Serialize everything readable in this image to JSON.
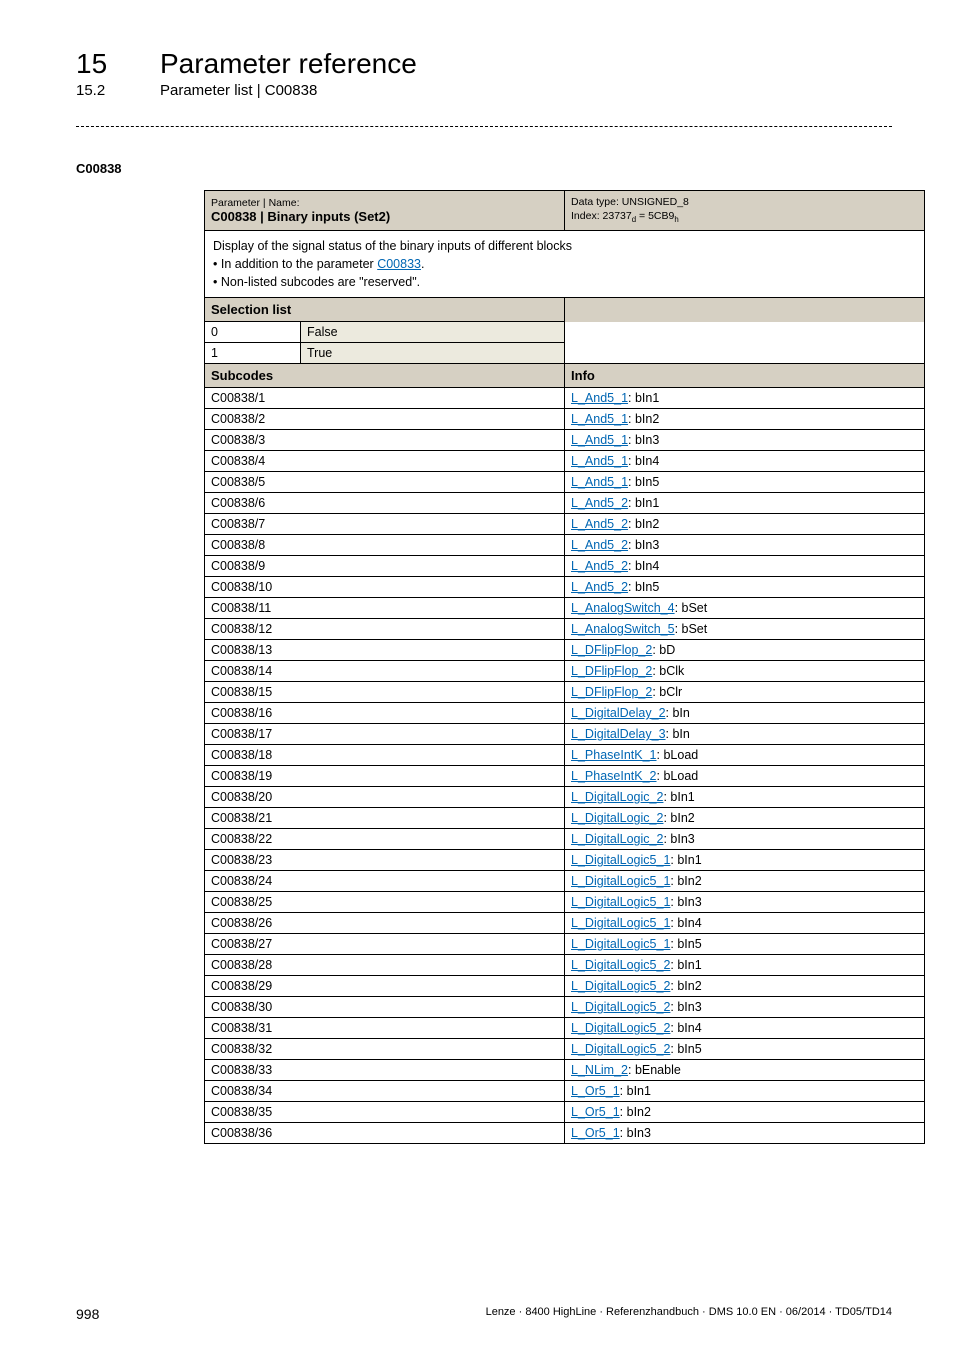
{
  "header": {
    "chapter_num": "15",
    "chapter_title": "Parameter reference",
    "section_num": "15.2",
    "section_title": "Parameter list | C00838"
  },
  "anchor": "C00838",
  "param_header": {
    "label": "Parameter | Name:",
    "name": "C00838 | Binary inputs (Set2)",
    "dtype": "Data type: UNSIGNED_8",
    "index_prefix": "Index: 23737",
    "index_sub1": "d",
    "index_mid": " = 5CB9",
    "index_sub2": "h"
  },
  "description": {
    "line1": "Display of the signal status of the binary inputs of different blocks",
    "bullet1_pre": " • In addition to the parameter ",
    "bullet1_link": "C00833",
    "bullet1_post": ".",
    "bullet2": " • Non-listed subcodes are \"reserved\"."
  },
  "labels": {
    "selection_list": "Selection list",
    "subcodes": "Subcodes",
    "info": "Info"
  },
  "selection": [
    {
      "val": "0",
      "label": "False"
    },
    {
      "val": "1",
      "label": "True"
    }
  ],
  "rows": [
    {
      "code": "C00838/1",
      "link": "L_And5_1",
      "suffix": ": bIn1"
    },
    {
      "code": "C00838/2",
      "link": "L_And5_1",
      "suffix": ": bIn2"
    },
    {
      "code": "C00838/3",
      "link": "L_And5_1",
      "suffix": ": bIn3"
    },
    {
      "code": "C00838/4",
      "link": "L_And5_1",
      "suffix": ": bIn4"
    },
    {
      "code": "C00838/5",
      "link": "L_And5_1",
      "suffix": ": bIn5"
    },
    {
      "code": "C00838/6",
      "link": "L_And5_2",
      "suffix": ": bIn1"
    },
    {
      "code": "C00838/7",
      "link": "L_And5_2",
      "suffix": ": bIn2"
    },
    {
      "code": "C00838/8",
      "link": "L_And5_2",
      "suffix": ": bIn3"
    },
    {
      "code": "C00838/9",
      "link": "L_And5_2",
      "suffix": ": bIn4"
    },
    {
      "code": "C00838/10",
      "link": "L_And5_2",
      "suffix": ": bIn5"
    },
    {
      "code": "C00838/11",
      "link": "L_AnalogSwitch_4",
      "suffix": ": bSet"
    },
    {
      "code": "C00838/12",
      "link": "L_AnalogSwitch_5",
      "suffix": ": bSet"
    },
    {
      "code": "C00838/13",
      "link": "L_DFlipFlop_2",
      "suffix": ": bD"
    },
    {
      "code": "C00838/14",
      "link": "L_DFlipFlop_2",
      "suffix": ": bClk"
    },
    {
      "code": "C00838/15",
      "link": "L_DFlipFlop_2",
      "suffix": ": bClr"
    },
    {
      "code": "C00838/16",
      "link": "L_DigitalDelay_2",
      "suffix": ": bIn"
    },
    {
      "code": "C00838/17",
      "link": "L_DigitalDelay_3",
      "suffix": ": bIn"
    },
    {
      "code": "C00838/18",
      "link": "L_PhaseIntK_1",
      "suffix": ": bLoad"
    },
    {
      "code": "C00838/19",
      "link": "L_PhaseIntK_2",
      "suffix": ": bLoad"
    },
    {
      "code": "C00838/20",
      "link": "L_DigitalLogic_2",
      "suffix": ": bIn1"
    },
    {
      "code": "C00838/21",
      "link": "L_DigitalLogic_2",
      "suffix": ": bIn2"
    },
    {
      "code": "C00838/22",
      "link": "L_DigitalLogic_2",
      "suffix": ": bIn3"
    },
    {
      "code": "C00838/23",
      "link": "L_DigitalLogic5_1",
      "suffix": ": bIn1"
    },
    {
      "code": "C00838/24",
      "link": "L_DigitalLogic5_1",
      "suffix": ": bIn2"
    },
    {
      "code": "C00838/25",
      "link": "L_DigitalLogic5_1",
      "suffix": ": bIn3"
    },
    {
      "code": "C00838/26",
      "link": "L_DigitalLogic5_1",
      "suffix": ": bIn4"
    },
    {
      "code": "C00838/27",
      "link": "L_DigitalLogic5_1",
      "suffix": ": bIn5"
    },
    {
      "code": "C00838/28",
      "link": "L_DigitalLogic5_2",
      "suffix": ": bIn1"
    },
    {
      "code": "C00838/29",
      "link": "L_DigitalLogic5_2",
      "suffix": ": bIn2"
    },
    {
      "code": "C00838/30",
      "link": "L_DigitalLogic5_2",
      "suffix": ": bIn3"
    },
    {
      "code": "C00838/31",
      "link": "L_DigitalLogic5_2",
      "suffix": ": bIn4"
    },
    {
      "code": "C00838/32",
      "link": "L_DigitalLogic5_2",
      "suffix": ": bIn5"
    },
    {
      "code": "C00838/33",
      "link": "L_NLim_2",
      "suffix": ": bEnable"
    },
    {
      "code": "C00838/34",
      "link": "L_Or5_1",
      "suffix": ": bIn1"
    },
    {
      "code": "C00838/35",
      "link": "L_Or5_1",
      "suffix": ": bIn2"
    },
    {
      "code": "C00838/36",
      "link": "L_Or5_1",
      "suffix": ": bIn3"
    }
  ],
  "footer": {
    "page": "998",
    "text": "Lenze · 8400 HighLine · Referenzhandbuch · DMS 10.0 EN · 06/2014 · TD05/TD14"
  }
}
